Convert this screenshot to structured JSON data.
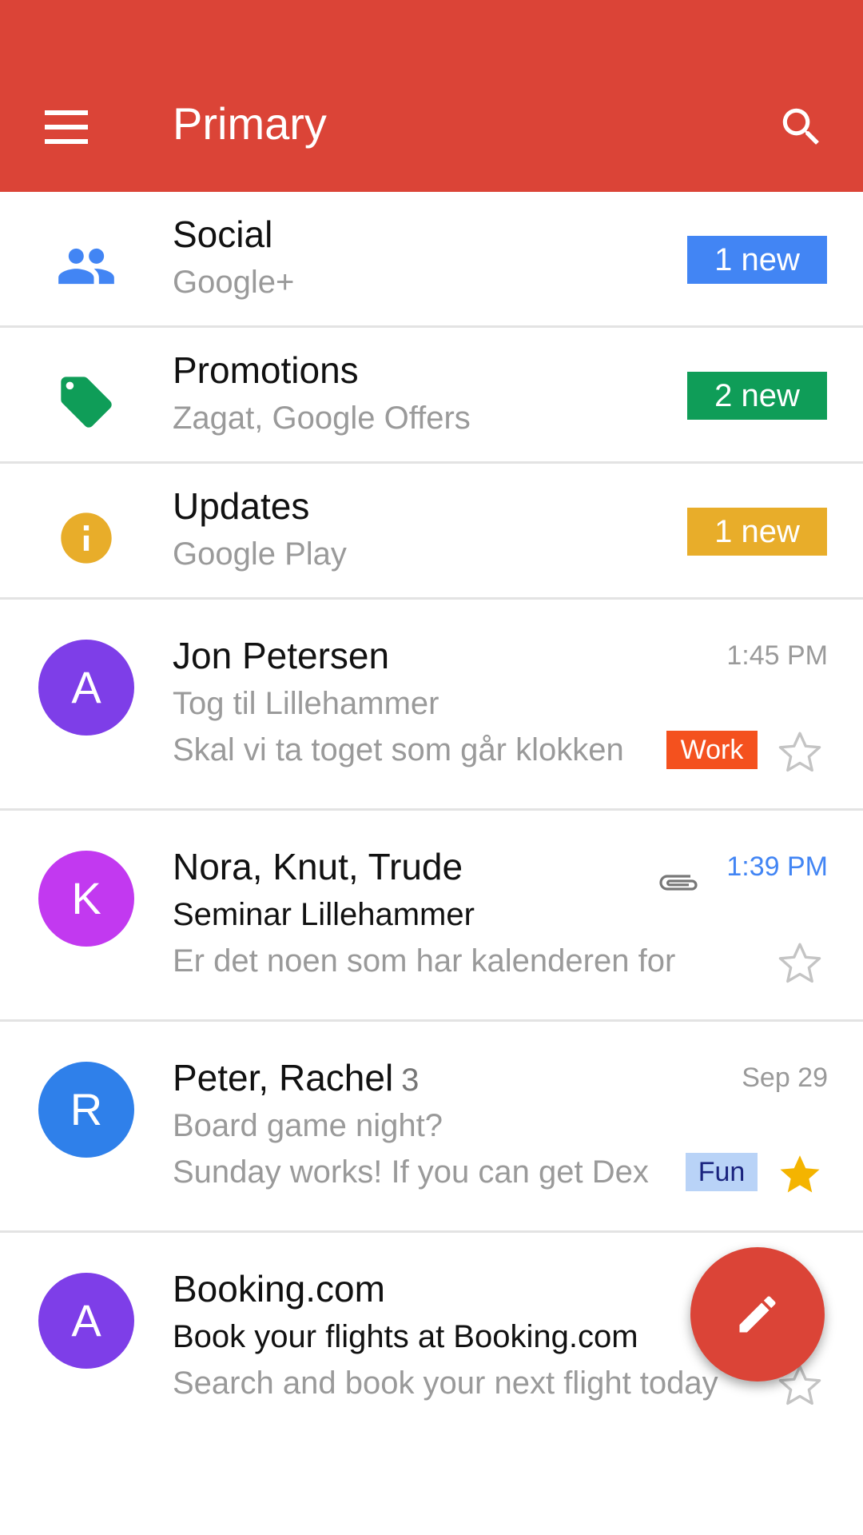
{
  "appbar": {
    "title": "Primary",
    "menu_icon": "menu-icon",
    "search_icon": "search-icon"
  },
  "colors": {
    "appbar": "#db4437",
    "social": "#4285f4",
    "promotions": "#0f9d58",
    "updates": "#e8ad2a"
  },
  "categories": [
    {
      "title": "Social",
      "sub": "Google+",
      "badge": "1 new",
      "icon": "people-icon",
      "color": "#4285f4"
    },
    {
      "title": "Promotions",
      "sub": "Zagat, Google Offers",
      "badge": "2 new",
      "icon": "tag-icon",
      "color": "#0f9d58"
    },
    {
      "title": "Updates",
      "sub": "Google Play",
      "badge": "1 new",
      "icon": "info-icon",
      "color": "#e8ad2a"
    }
  ],
  "mails": [
    {
      "initial": "A",
      "avatar_color": "#7e3ee8",
      "sender": "Jon Petersen",
      "count": "",
      "time": "1:45 PM",
      "subject": "Tog til Lillehammer",
      "snippet": "Skal vi ta toget som går klokken",
      "label": "Work",
      "label_bg": "#f4511e",
      "label_color": "#ffffff",
      "starred": false,
      "unread": false,
      "attachment": false
    },
    {
      "initial": "K",
      "avatar_color": "#c239f0",
      "sender": "Nora, Knut, Trude",
      "count": "",
      "time": "1:39 PM",
      "subject": "Seminar Lillehammer",
      "snippet": "Er det noen som har kalenderen for",
      "label": "",
      "starred": false,
      "unread": true,
      "attachment": true
    },
    {
      "initial": "R",
      "avatar_color": "#2f80ea",
      "sender": "Peter, Rachel",
      "count": "3",
      "time": "Sep 29",
      "subject": "Board game night?",
      "snippet": "Sunday works! If you can get Dex",
      "label": "Fun",
      "label_bg": "#b9d3f7",
      "label_color": "#1a237e",
      "starred": true,
      "unread": false,
      "attachment": false
    },
    {
      "initial": "A",
      "avatar_color": "#7e3ee8",
      "sender": "Booking.com",
      "count": "",
      "time": "",
      "subject": "Book your flights at Booking.com",
      "snippet": "Search and book your next flight today",
      "label": "",
      "starred": false,
      "unread": true,
      "attachment": false
    }
  ],
  "fab": {
    "icon": "pencil-icon"
  }
}
